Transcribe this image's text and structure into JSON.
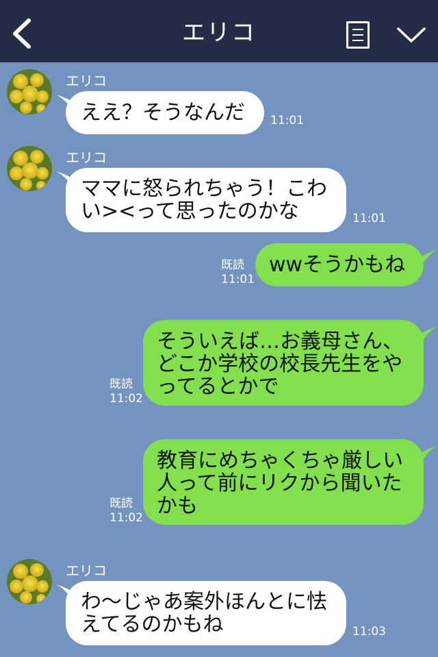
{
  "header": {
    "title": "エリコ",
    "icons": {
      "back": "chevron-left-icon",
      "notes": "note-list-icon",
      "menu": "chevron-down-icon"
    }
  },
  "colors": {
    "header": "#232d45",
    "background": "#7494c0",
    "incoming": "#ffffff",
    "outgoing": "#82e04c"
  },
  "messages": [
    {
      "from": "エリコ",
      "lines": [
        "ええ？そうなんだ"
      ],
      "time": "11:01"
    },
    {
      "from": "エリコ",
      "lines": [
        "ママに怒られちゃう！こわ",
        "い><って思ったのかな"
      ],
      "time": "11:01"
    },
    {
      "from": "me",
      "read": "既読",
      "lines": [
        "wwそうかもね"
      ],
      "time": "11:01"
    },
    {
      "from": "me",
      "read": "既読",
      "lines": [
        "そういえば…お義母さん、",
        "どこか学校の校長先生をや",
        "ってるとかで"
      ],
      "time": "11:02"
    },
    {
      "from": "me",
      "read": "既読",
      "lines": [
        "教育にめちゃくちゃ厳しい",
        "人って前にリクから聞いた",
        "かも"
      ],
      "time": "11:02"
    },
    {
      "from": "エリコ",
      "lines": [
        "わ〜じゃあ案外ほんとに怯",
        "えてるのかもね"
      ],
      "time": "11:03"
    }
  ]
}
